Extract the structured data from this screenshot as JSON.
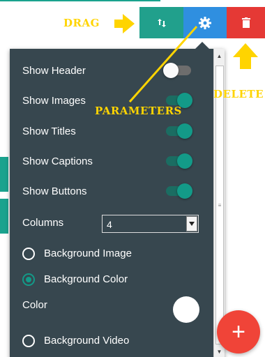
{
  "toolbar": {
    "drag_icon": "swap-vertical-icon",
    "params_icon": "gear-icon",
    "delete_icon": "trash-icon",
    "colors": {
      "drag": "#21a08c",
      "params": "#2f8fe0",
      "delete": "#e53935"
    }
  },
  "annotations": {
    "drag": "DRAG",
    "parameters": "PARAMETERS",
    "delete": "DELETE"
  },
  "settings": {
    "toggles": [
      {
        "label": "Show Header",
        "on": false
      },
      {
        "label": "Show Images",
        "on": true
      },
      {
        "label": "Show Titles",
        "on": true
      },
      {
        "label": "Show Captions",
        "on": true
      },
      {
        "label": "Show Buttons",
        "on": true
      }
    ],
    "columns": {
      "label": "Columns",
      "value": "4"
    },
    "background_options": [
      {
        "label": "Background Image",
        "checked": false
      },
      {
        "label": "Background Color",
        "checked": true
      },
      {
        "label": "Background Video",
        "checked": false
      }
    ],
    "color": {
      "label": "Color",
      "value": "#ffffff"
    }
  },
  "fab": {
    "label": "+",
    "color": "#f04438"
  },
  "accent": "#139a88"
}
